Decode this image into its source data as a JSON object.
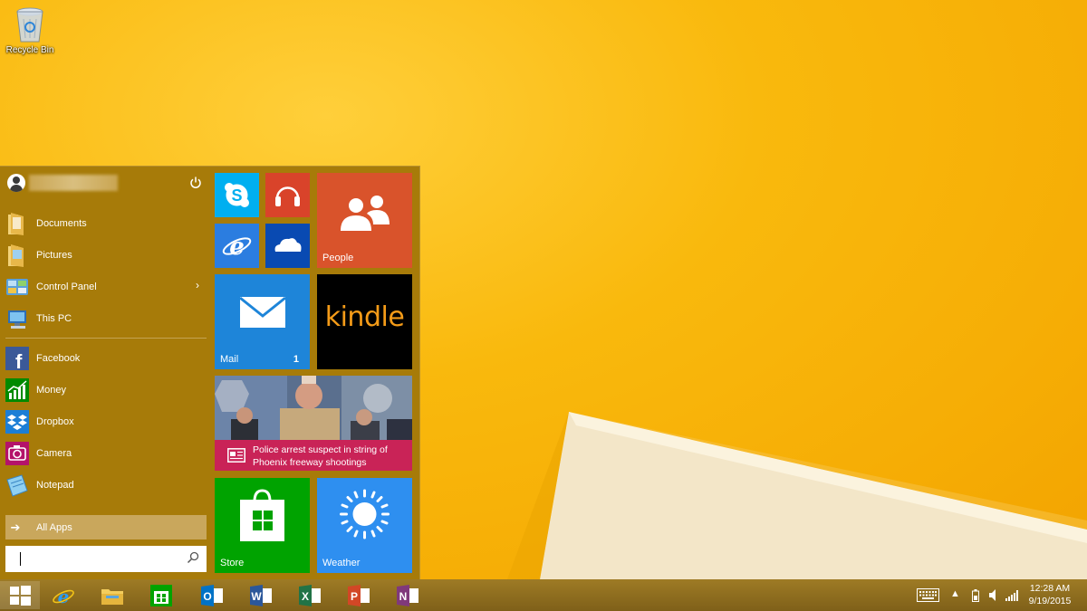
{
  "desktop": {
    "recycle_bin_label": "Recycle Bin"
  },
  "start_menu": {
    "user_name": "",
    "places": [
      {
        "label": "Documents",
        "icon": "documents-folder-icon"
      },
      {
        "label": "Pictures",
        "icon": "pictures-folder-icon"
      },
      {
        "label": "Control Panel",
        "icon": "control-panel-icon",
        "has_submenu": true
      },
      {
        "label": "This PC",
        "icon": "this-pc-icon"
      }
    ],
    "apps": [
      {
        "label": "Facebook",
        "icon": "facebook-icon"
      },
      {
        "label": "Money",
        "icon": "money-icon"
      },
      {
        "label": "Dropbox",
        "icon": "dropbox-icon"
      },
      {
        "label": "Camera",
        "icon": "camera-icon"
      },
      {
        "label": "Notepad",
        "icon": "notepad-icon"
      }
    ],
    "all_apps_label": "All Apps",
    "search_value": ""
  },
  "tiles": {
    "people_label": "People",
    "mail_label": "Mail",
    "mail_count": "1",
    "kindle_text": "kindle",
    "news_headline": "Police arrest suspect in string of Phoenix freeway shootings",
    "store_label": "Store",
    "weather_label": "Weather"
  },
  "taskbar": {
    "pinned": [
      "internet-explorer",
      "file-explorer",
      "store",
      "outlook",
      "word",
      "excel",
      "powerpoint",
      "onenote"
    ],
    "clock_time": "12:28 AM",
    "clock_date": "9/19/2015"
  },
  "colors": {
    "start_bg": "#a77b09",
    "desktop_bg": "#f6b407",
    "mail_tile": "#1e85d9",
    "people_tile": "#d9532b",
    "store_tile": "#00a300",
    "weather_tile": "#2e8ff0",
    "news_bar": "#c92357"
  }
}
